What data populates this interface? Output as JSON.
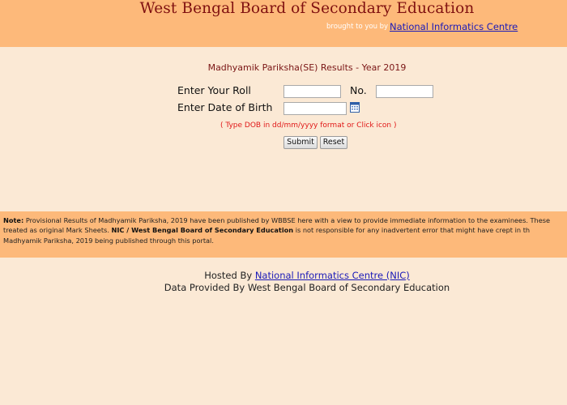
{
  "header": {
    "title": "West Bengal Board of Secondary Education",
    "brought_by": "brought to you by",
    "nic_link": "National Informatics Centre"
  },
  "form": {
    "title": "Madhyamik Pariksha(SE) Results - Year 2019",
    "roll_label": "Enter Your Roll",
    "no_label": "No.",
    "roll_value": "",
    "no_value": "",
    "dob_label": "Enter Date of Birth",
    "dob_value": "",
    "dob_hint": "( Type DOB in dd/mm/yyyy format or Click icon    )",
    "calendar_icon": "calendar-icon",
    "submit_label": "Submit",
    "reset_label": "Reset"
  },
  "note": {
    "prefix": "Note:",
    "line1": " Provisional Results of Madhyamik Pariksha, 2019 have been published by WBBSE here with a view to provide immediate information to the examinees. These",
    "line2_a": "treated as original Mark Sheets. ",
    "line2_bold": "NIC / West Bengal Board of Secondary Education",
    "line2_b": " is not responsible for any inadvertent error that might have crept in th",
    "line3": "Madhyamik Pariksha, 2019 being published through this portal."
  },
  "footer": {
    "hosted_by": "Hosted By ",
    "hosted_link": "National Informatics Centre (NIC)",
    "data_provided": "Data Provided By West Bengal Board of Secondary Education"
  },
  "colors": {
    "band": "#fdb97a",
    "background": "#fbe9d5",
    "title": "#7f1010",
    "link": "#1a1ab8",
    "hint": "#e01818"
  }
}
